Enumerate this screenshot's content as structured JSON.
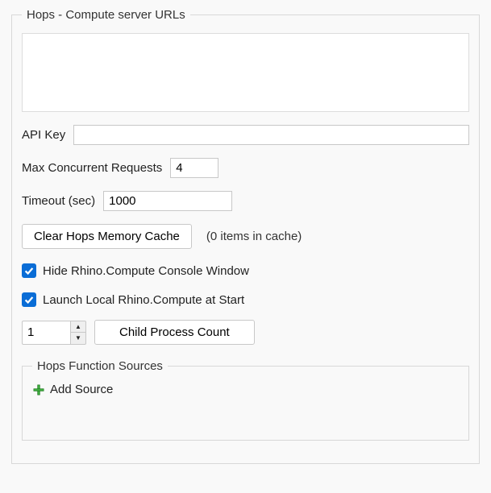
{
  "groupbox": {
    "title": "Hops - Compute server URLs"
  },
  "urls": {
    "value": ""
  },
  "api_key": {
    "label": "API Key",
    "value": ""
  },
  "max_concurrent": {
    "label": "Max Concurrent Requests",
    "value": "4"
  },
  "timeout": {
    "label": "Timeout (sec)",
    "value": "1000"
  },
  "clear_cache": {
    "button_label": "Clear Hops Memory Cache",
    "info": "(0 items in cache)"
  },
  "checkboxes": {
    "hide_console": {
      "label": "Hide Rhino.Compute Console Window",
      "checked": true
    },
    "launch_local": {
      "label": "Launch Local Rhino.Compute at Start",
      "checked": true
    }
  },
  "child_process": {
    "count": "1",
    "button_label": "Child Process Count"
  },
  "function_sources": {
    "title": "Hops Function Sources",
    "add_label": "Add Source"
  }
}
